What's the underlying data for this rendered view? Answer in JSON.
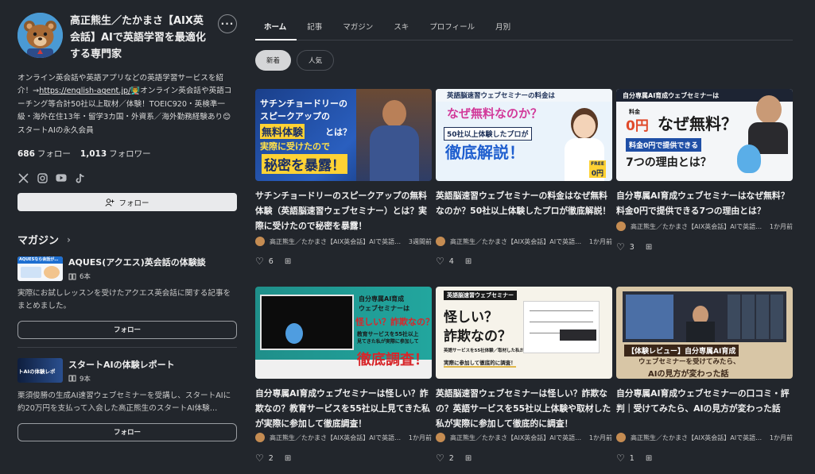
{
  "profile": {
    "name": "高正熊生／たかまさ【AIX英会話】AIで英語学習を最適化する専門家",
    "bio_before_link": "オンライン英会話や英語アプリなどの英語学習サービスを紹介！→",
    "bio_link": "https://english-agent.jp/",
    "bio_after_link": "👨‍🏫オンライン英会話や英語コーチング等合計50社以上取材／体験！TOEIC920・英検準一級・海外在住13年・留学3カ国・外資系／海外勤務経験あり😊スタートAIの永久会員",
    "following_count": "686",
    "following_label": "フォロー",
    "followers_count": "1,013",
    "followers_label": "フォロワー",
    "follow_button": "フォロー",
    "more_label": "···",
    "social_icons": [
      "x-icon",
      "instagram-icon",
      "youtube-icon",
      "tiktok-icon"
    ]
  },
  "magazines": {
    "heading": "マガジン",
    "items": [
      {
        "title": "AQUES(アクエス)英会話の体験談",
        "count": "6本",
        "description": "実際にお試しレッスンを受けたアクエス英会話に関する記事をまとめました。",
        "button": "フォロー",
        "thumb_text": "AQUESなら会話が…"
      },
      {
        "title": "スタートAIの体験レポート",
        "count": "9本",
        "description": "栗須俊勝の生成AI速習ウェブセミナーを受講し、スタートAIに約20万円を支払って入会した高正熊生のスタートAI体験…",
        "button": "フォロー",
        "thumb_text": "トAIの体験レポ"
      }
    ]
  },
  "tabs": [
    "ホーム",
    "記事",
    "マガジン",
    "スキ",
    "プロフィール",
    "月別"
  ],
  "filters": [
    "新着",
    "人気"
  ],
  "cards": [
    {
      "title": "サチンチョードリーのスピークアップの無料体験（英語脳速習ウェブセミナー）とは？実際に受けたので秘密を暴露！",
      "author": "高正熊生／たかまさ【AIX英会話】AIで英語学習を最適化する専門家",
      "time": "3週間前",
      "likes": "6",
      "thumb": {
        "l1": "サチンチョードリーの",
        "l2": "スピークアップの",
        "l3": "無料体験",
        "l4": "とは？",
        "l5": "実際に受けたので",
        "l6": "秘密を暴露！"
      }
    },
    {
      "title": "英語脳速習ウェブセミナーの料金はなぜ無料なのか？50社以上体験したプロが徹底解説！",
      "author": "高正熊生／たかまさ【AIX英会話】AIで英語学習を最適化する専門家",
      "time": "1か月前",
      "likes": "4",
      "thumb": {
        "l1": "英語脳速習ウェブセミナーの料金は",
        "l2": "なぜ無料なのか？",
        "l3": "50社以上体験したプロが",
        "l4": "徹底解説！",
        "l5": "FREE",
        "l6": "0円"
      }
    },
    {
      "title": "自分専属AI育成ウェブセミナーはなぜ無料？料金0円で提供できる7つの理由とは？",
      "author": "高正熊生／たかまさ【AIX英会話】AIで英語学習を最適化する専門家",
      "time": "1か月前",
      "likes": "3",
      "thumb": {
        "l1": "自分専属AI育成ウェブセミナーは",
        "l2": "なぜ無料？",
        "l3": "料金0円で提供できる",
        "l4": "7つの理由とは？",
        "l5": "料金",
        "l6": "0円"
      }
    },
    {
      "title": "自分専属AI育成ウェブセミナーは怪しい？詐欺なの？教育サービスを55社以上見てきた私が実際に参加して徹底調査！",
      "author": "高正熊生／たかまさ【AIX英会話】AIで英語学習を最適化する専門家",
      "time": "1か月前",
      "likes": "2",
      "thumb": {
        "l1": "自分専属AI育成",
        "l2": "ウェブセミナーは",
        "l3": "怪しい？詐欺なの？",
        "l4": "教育サービスを55社以上",
        "l5": "見てきた私が実際に参加して",
        "l6": "徹底調査！"
      }
    },
    {
      "title": "英語脳速習ウェブセミナーは怪しい？詐欺なの？英語サービスを55社以上体験や取材した私が実際に参加して徹底的に調査！",
      "author": "高正熊生／たかまさ【AIX英会話】AIで英語学習を最適化する専門家",
      "time": "1か月前",
      "likes": "2",
      "thumb": {
        "l1": "英語脳速習ウェブセミナー",
        "l2": "怪しい？",
        "l3": "詐欺なの？",
        "l4": "英語サービスを55社体験／取材した私が",
        "l5": "実際に参加して徹底的に調査！",
        "l6": ""
      }
    },
    {
      "title": "自分専属AI育成ウェブセミナーの口コミ・評判｜受けてみたら、AIの見方が変わった話",
      "author": "高正熊生／たかまさ【AIX英会話】AIで英語学習を最適化する専門家",
      "time": "1か月前",
      "likes": "1",
      "thumb": {
        "l1": "【体験レビュー】自分専属AI育成",
        "l2": "ウェブセミナーを受けてみたら、",
        "l3": "AIの見方が変わった話",
        "l4": "",
        "l5": "",
        "l6": ""
      }
    }
  ]
}
